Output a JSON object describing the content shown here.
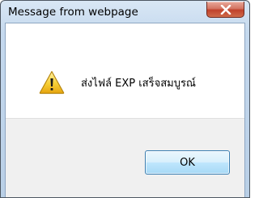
{
  "dialog": {
    "title": "Message from webpage",
    "message": "ส่งไฟล์ EXP เสร็จสมบูรณ์",
    "icon": "warning-icon",
    "ok_label": "OK"
  }
}
